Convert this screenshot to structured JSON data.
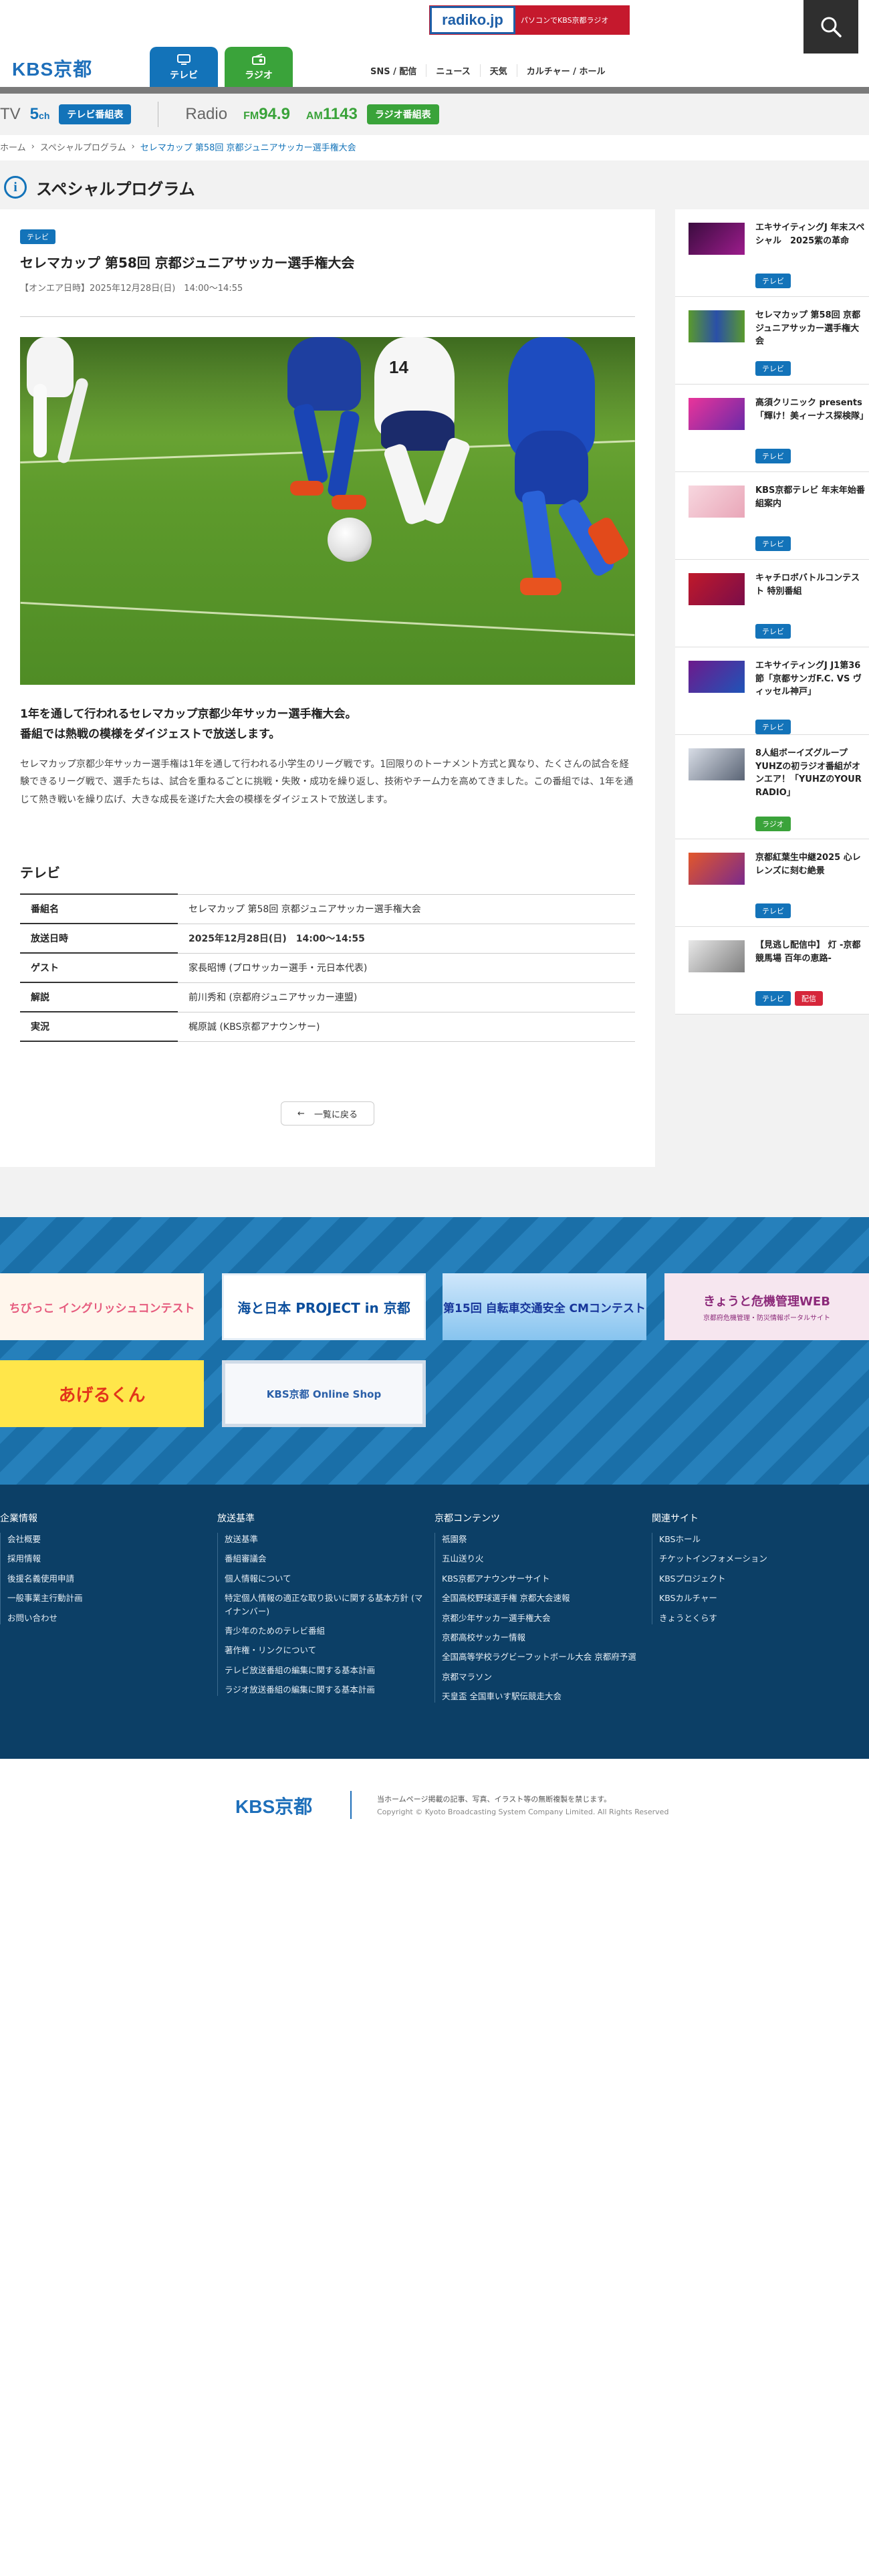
{
  "header": {
    "logo": "KBS京都",
    "radiko": {
      "logo": "radiko.jp",
      "text": "パソコンでKBS京都ラジオ"
    },
    "tabs": [
      {
        "label": "テレビ"
      },
      {
        "label": "ラジオ"
      }
    ],
    "nav": [
      "SNS / 配信",
      "ニュース",
      "天気",
      "カルチャー / ホール"
    ]
  },
  "onair": {
    "tv_label": "TV",
    "tv_channel": "5",
    "tv_channel_unit": "ch",
    "tv_schedule_label": "テレビ番組表",
    "radio_label": "Radio",
    "fm_label": "FM",
    "fm_freq": "94.9",
    "am_label": "AM",
    "am_freq": "1143",
    "radio_schedule_label": "ラジオ番組表"
  },
  "breadcrumb": [
    "ホーム",
    "スペシャルプログラム",
    "セレマカップ 第58回 京都ジュニアサッカー選手権大会"
  ],
  "page_heading": "スペシャルプログラム",
  "article": {
    "category": "テレビ",
    "title": "セレマカップ 第58回 京都ジュニアサッカー選手権大会",
    "onair_date": "【オンエア日時】2025年12月28日(日)　14:00〜14:55",
    "jersey_number": "14",
    "lead_1": "1年を通して行われるセレマカップ京都少年サッカー選手権大会。",
    "lead_2": "番組では熱戦の模様をダイジェストで放送します。",
    "body": "セレマカップ京都少年サッカー選手権は1年を通して行われる小学生のリーグ戦です。1回限りのトーナメント方式と異なり、たくさんの試合を経験できるリーグ戦で、選手たちは、試合を重ねるごとに挑戦・失敗・成功を繰り返し、技術やチーム力を高めてきました。この番組では、1年を通じて熱き戦いを繰り広げ、大きな成長を遂げた大会の模様をダイジェストで放送します。",
    "section_title": "テレビ",
    "info": [
      {
        "key": "番組名",
        "value": "セレマカップ 第58回 京都ジュニアサッカー選手権大会"
      },
      {
        "key": "放送日時",
        "value": "2025年12月28日(日)　14:00〜14:55"
      },
      {
        "key": "ゲスト",
        "value": "家長昭博 (プロサッカー選手・元日本代表)"
      },
      {
        "key": "解説",
        "value": "前川秀和 (京都府ジュニアサッカー連盟)"
      },
      {
        "key": "実況",
        "value": "梶原誠 (KBS京都アナウンサー)"
      }
    ],
    "back_label": "一覧に戻る"
  },
  "sidebar": [
    {
      "title": "エキサイティングJ 年末スペシャル　2025紫の革命",
      "badges": [
        "テレビ"
      ]
    },
    {
      "title": "セレマカップ 第58回 京都ジュニアサッカー選手権大会",
      "badges": [
        "テレビ"
      ]
    },
    {
      "title": "高須クリニック presents「輝け！美ィーナス探検隊」",
      "badges": [
        "テレビ"
      ]
    },
    {
      "title": "KBS京都テレビ 年末年始番組案内",
      "badges": [
        "テレビ"
      ]
    },
    {
      "title": "キャチロボバトルコンテスト 特別番組",
      "badges": [
        "テレビ"
      ]
    },
    {
      "title": "エキサイティングJ J1第36節「京都サンガF.C. VS ヴィッセル神戸」",
      "badges": [
        "テレビ"
      ]
    },
    {
      "title": "8人組ボーイズグループYUHZの初ラジオ番組がオンエア！「YUHZのYOUR RADIO」",
      "badges": [
        "ラジオ"
      ]
    },
    {
      "title": "京都紅葉生中継2025 心レレンズに刻む絶景",
      "badges": [
        "テレビ"
      ]
    },
    {
      "title": "【見逃し配信中】 灯 -京都競馬場 百年の恵路-",
      "badges": [
        "テレビ",
        "配信"
      ]
    }
  ],
  "banners": [
    {
      "text": "ちびっこ イングリッシュコンテスト"
    },
    {
      "text": "海と日本 PROJECT in 京都"
    },
    {
      "text": "第15回 自転車交通安全 CMコンテスト"
    },
    {
      "text": "きょうと危機管理WEB",
      "sub": "京都府危機管理・防災情報ポータルサイト"
    },
    {
      "text": "あげるくん"
    },
    {
      "text": "KBS京都 Online Shop"
    }
  ],
  "footer": {
    "columns": [
      {
        "title": "企業情報",
        "links": [
          "会社概要",
          "採用情報",
          "後援名義使用申請",
          "一般事業主行動計画",
          "お問い合わせ"
        ]
      },
      {
        "title": "放送基準",
        "links": [
          "放送基準",
          "番組審議会",
          "個人情報について",
          "特定個人情報の適正な取り扱いに関する基本方針 (マイナンバー)",
          "青少年のためのテレビ番組",
          "著作権・リンクについて",
          "テレビ放送番組の編集に関する基本計画",
          "ラジオ放送番組の編集に関する基本計画"
        ]
      },
      {
        "title": "京都コンテンツ",
        "links": [
          "祇園祭",
          "五山送り火",
          "KBS京都アナウンサーサイト",
          "全国高校野球選手権 京都大会速報",
          "京都少年サッカー選手権大会",
          "京都高校サッカー情報",
          "全国高等学校ラグビーフットボール大会 京都府予選",
          "京都マラソン",
          "天皇盃 全国車いす駅伝競走大会"
        ]
      },
      {
        "title": "関連サイト",
        "links": [
          "KBSホール",
          "チケットインフォメーション",
          "KBSプロジェクト",
          "KBSカルチャー",
          "きょうとくらす"
        ]
      }
    ],
    "logo": "KBS京都",
    "note": "当ホームページ掲載の記事、写真、イラスト等の無断複製を禁じます。",
    "copyright": "Copyright © Kyoto Broadcasting System Company Limited. All Rights Reserved"
  }
}
